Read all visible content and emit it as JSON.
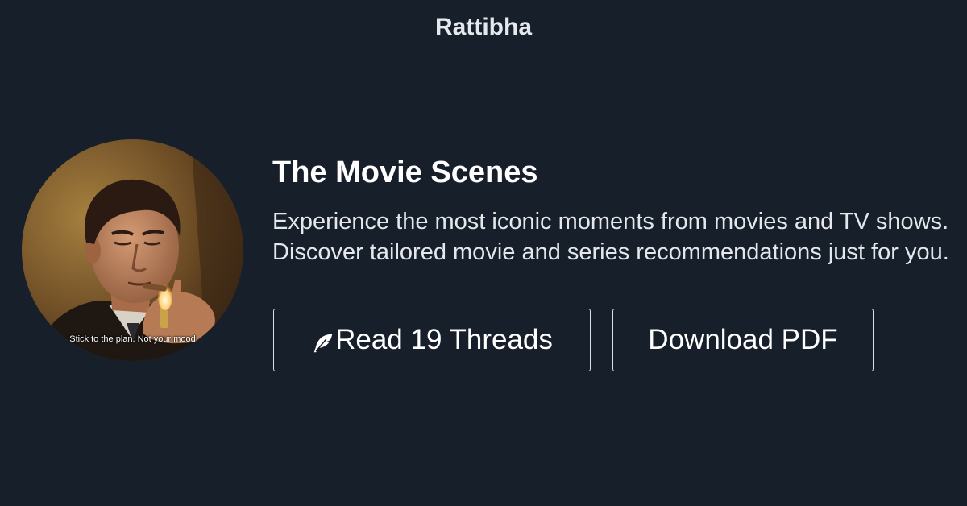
{
  "brand": "Rattibha",
  "avatar": {
    "caption": "Stick to the plan. Not your mood"
  },
  "profile": {
    "title": "The Movie Scenes",
    "description": "Experience the most iconic moments from movies and TV shows. Discover tailored movie and series recommendations just for you."
  },
  "actions": {
    "read_label": "Read 19 Threads",
    "read_icon": "feather-icon",
    "download_label": "Download PDF"
  },
  "colors": {
    "background": "#171f2b",
    "text": "#ffffff",
    "border": "#d9dde2"
  }
}
